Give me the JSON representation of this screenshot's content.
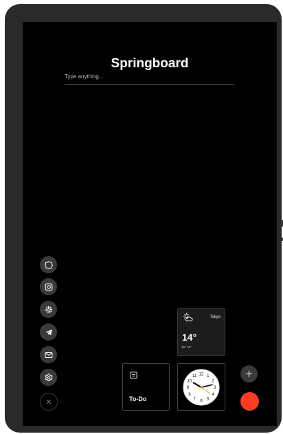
{
  "app": {
    "title": "Springboard"
  },
  "search": {
    "placeholder": "Type anything..."
  },
  "dock": {
    "icons": [
      {
        "name": "flower-settings-icon"
      },
      {
        "name": "instagram-icon"
      },
      {
        "name": "slack-icon"
      },
      {
        "name": "telegram-icon"
      },
      {
        "name": "mail-icon"
      },
      {
        "name": "gear-icon"
      }
    ],
    "close": "close-icon"
  },
  "weather": {
    "city": "Tokyo",
    "temperature": "14°",
    "range": "16°  10°",
    "icon": "partly-sunny-icon"
  },
  "todo": {
    "label": "To-Do",
    "icon": "note-icon"
  },
  "clock": {
    "numbers": [
      "12",
      "1",
      "2",
      "3",
      "4",
      "5",
      "6",
      "7",
      "8",
      "9",
      "10",
      "11"
    ]
  },
  "actions": {
    "add": "plus-icon",
    "record": "record-button"
  },
  "colors": {
    "background": "#000000",
    "accent": "#ff3b22",
    "icon_bg": "#3a3a3c"
  }
}
